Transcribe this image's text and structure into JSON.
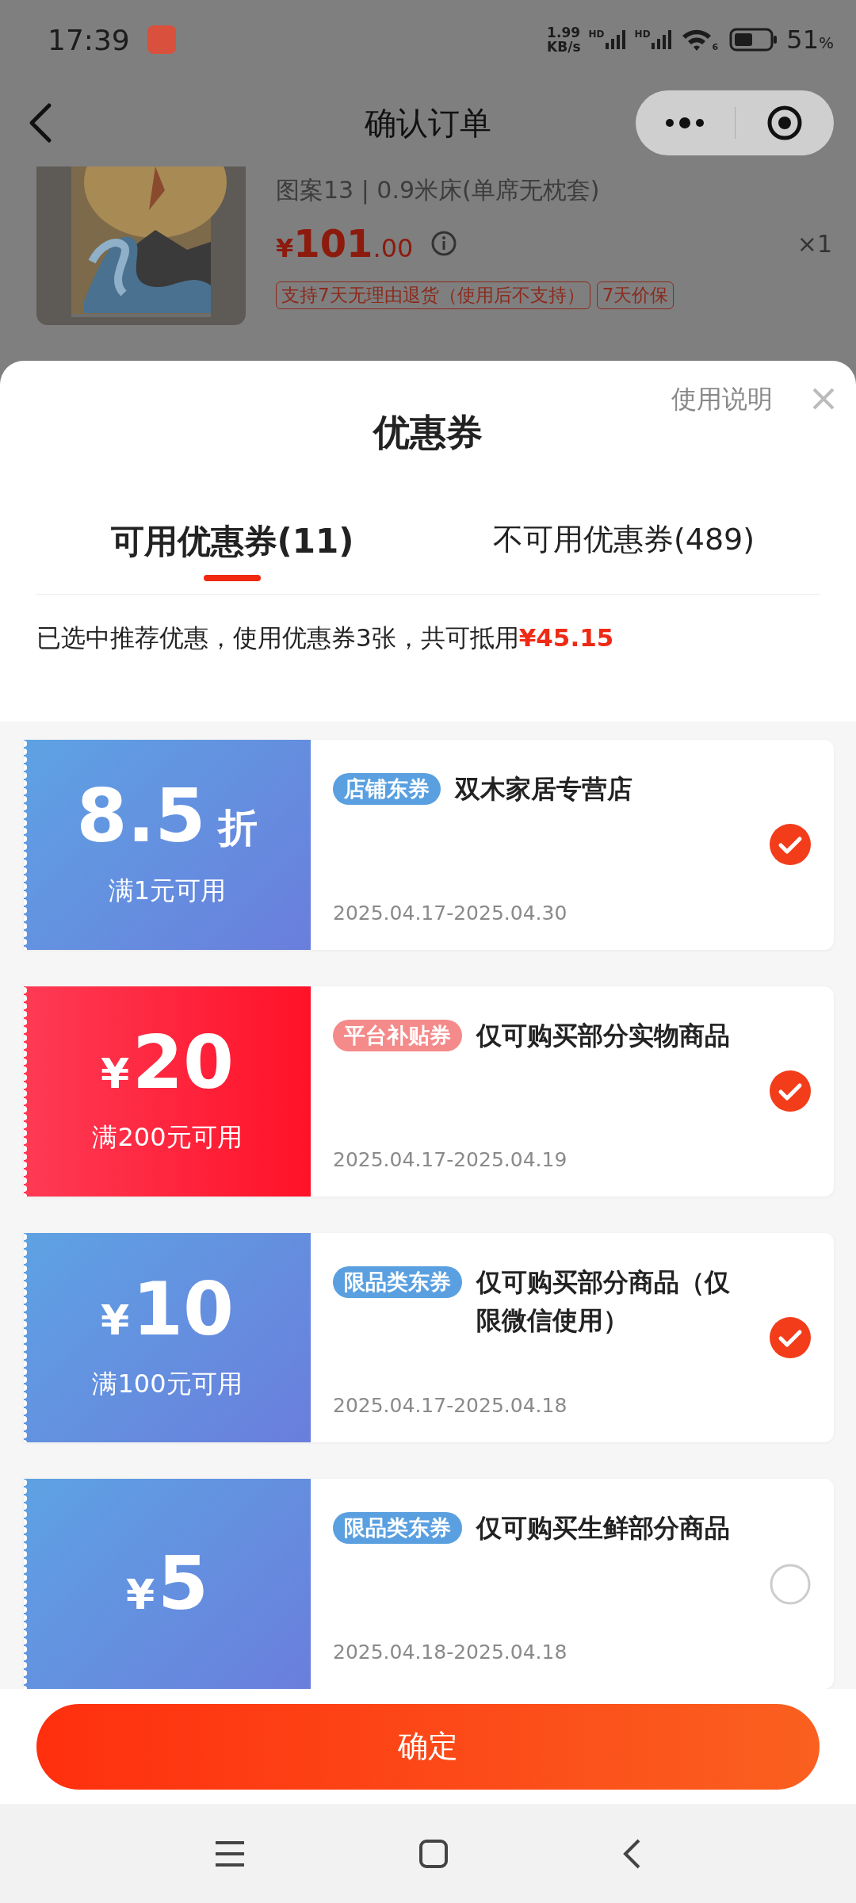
{
  "status_bar": {
    "time": "17:39",
    "speed": [
      "1.99",
      "KB/s"
    ],
    "signal_labels": [
      "HD",
      "HD"
    ],
    "wifi_label": "6",
    "battery": "51",
    "battery_unit": "%"
  },
  "header": {
    "title": "确认订单"
  },
  "product": {
    "spec": "图案13 | 0.9米床(单席无枕套)",
    "currency": "¥",
    "price_int": "101",
    "price_dec": ".00",
    "quantity": "×1",
    "tags": [
      "支持7天无理由退货（使用后不支持）",
      "7天价保"
    ]
  },
  "sheet": {
    "title": "优惠券",
    "help": "使用说明",
    "tabs": [
      {
        "label": "可用优惠券(11)",
        "selected": true
      },
      {
        "label": "不可用优惠券(489)",
        "selected": false
      }
    ],
    "summary": "已选中推荐优惠，使用优惠券3张，共可抵用**¥45.15**",
    "coupons": [
      {
        "kind": "store",
        "amount": "8.5",
        "unit": "折",
        "condition": "满1元可用",
        "tag": "店铺东券",
        "title": "双木家居专营店",
        "dates": "2025.04.17-2025.04.30",
        "selected": true
      },
      {
        "kind": "platform",
        "currency": "¥",
        "amount": "20",
        "condition": "满200元可用",
        "tag": "平台补贴券",
        "title": "仅可购买部分实物商品",
        "dates": "2025.04.17-2025.04.19",
        "selected": true
      },
      {
        "kind": "category",
        "currency": "¥",
        "amount": "10",
        "condition": "满100元可用",
        "tag": "限品类东券",
        "title": "仅可购买部分商品（仅限微信使用）",
        "dates": "2025.04.17-2025.04.18",
        "selected": true
      },
      {
        "kind": "category",
        "currency": "¥",
        "amount": "5",
        "tag": "限品类东券",
        "title": "仅可购买生鲜部分商品",
        "dates": "2025.04.18-2025.04.18",
        "selected": false
      }
    ],
    "confirm": "确定"
  }
}
